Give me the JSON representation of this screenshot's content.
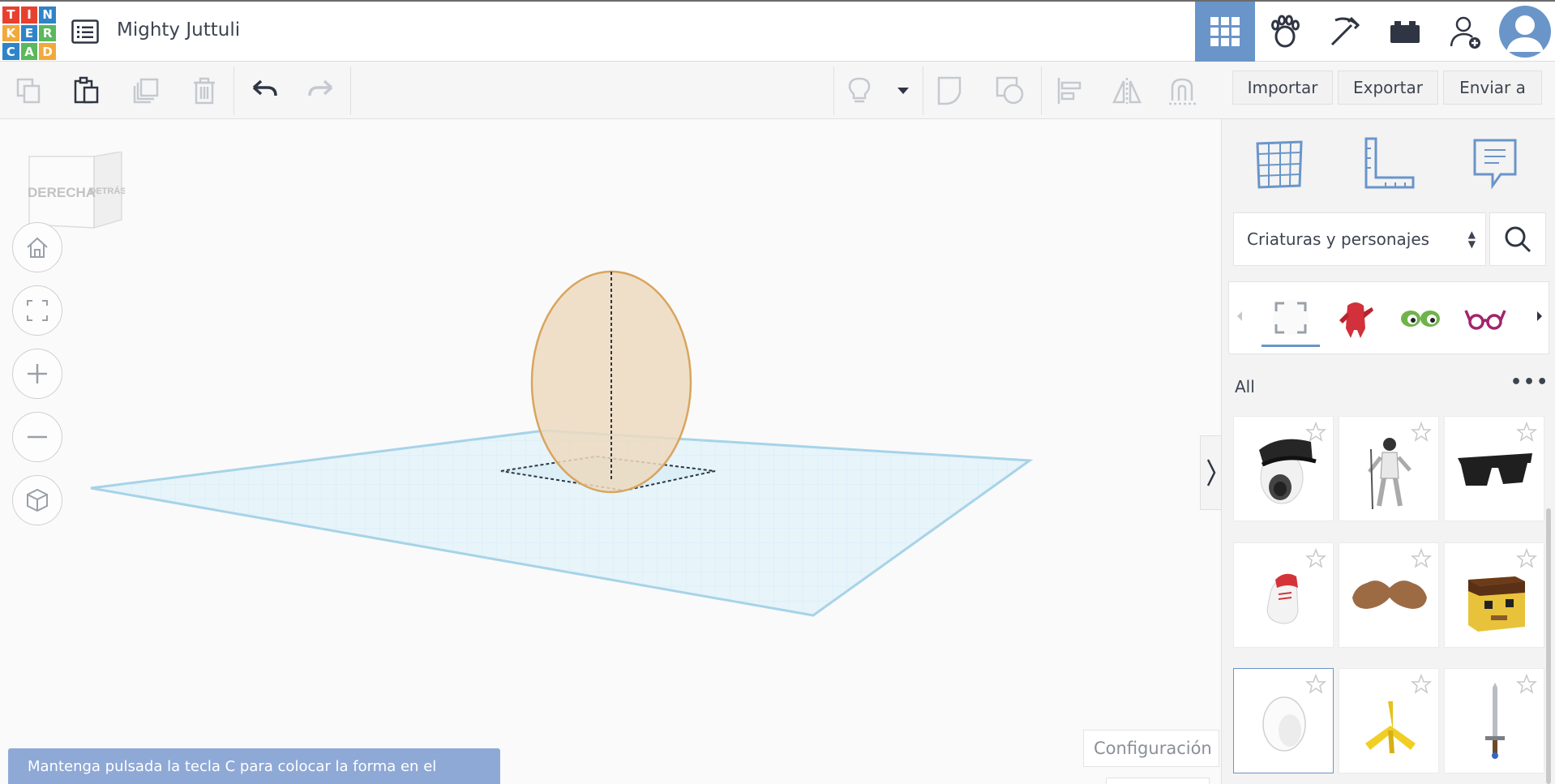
{
  "app": {
    "logo_letters": [
      "T",
      "I",
      "N",
      "K",
      "E",
      "R",
      "C",
      "A",
      "D"
    ],
    "logo_colors": [
      "#e8402f",
      "#e8402f",
      "#2f84c7",
      "#f2a93b",
      "#2f84c7",
      "#5cb85c",
      "#2f84c7",
      "#5cb85c",
      "#f2a93b"
    ],
    "design_title": "Mighty Juttuli"
  },
  "toolbar": {
    "import_label": "Importar",
    "export_label": "Exportar",
    "send_label": "Enviar a"
  },
  "viewcube": {
    "face_right": "DERECHA",
    "face_back": "DETRÁS"
  },
  "viewport": {
    "hint_text": "Mantenga pulsada la tecla C para colocar la forma en el",
    "settings_label": "Configuración"
  },
  "panel": {
    "category_select": "Criaturas y personajes",
    "section_label": "All",
    "more_label": "•••",
    "shapes": [
      {
        "name": "eyeball-hat-shape"
      },
      {
        "name": "astronaut-figure-shape"
      },
      {
        "name": "sunglasses-shape"
      },
      {
        "name": "shoe-shape"
      },
      {
        "name": "mustache-shape"
      },
      {
        "name": "block-head-shape"
      },
      {
        "name": "egg-shape"
      },
      {
        "name": "bird-foot-shape"
      },
      {
        "name": "sword-shape"
      }
    ]
  },
  "colors": {
    "accent": "#6a95c9",
    "egg_fill": "#ecd9c0",
    "egg_stroke": "#d9a55d",
    "workplane": "#d7eef7",
    "workplane_edge": "#9fcfe6"
  }
}
